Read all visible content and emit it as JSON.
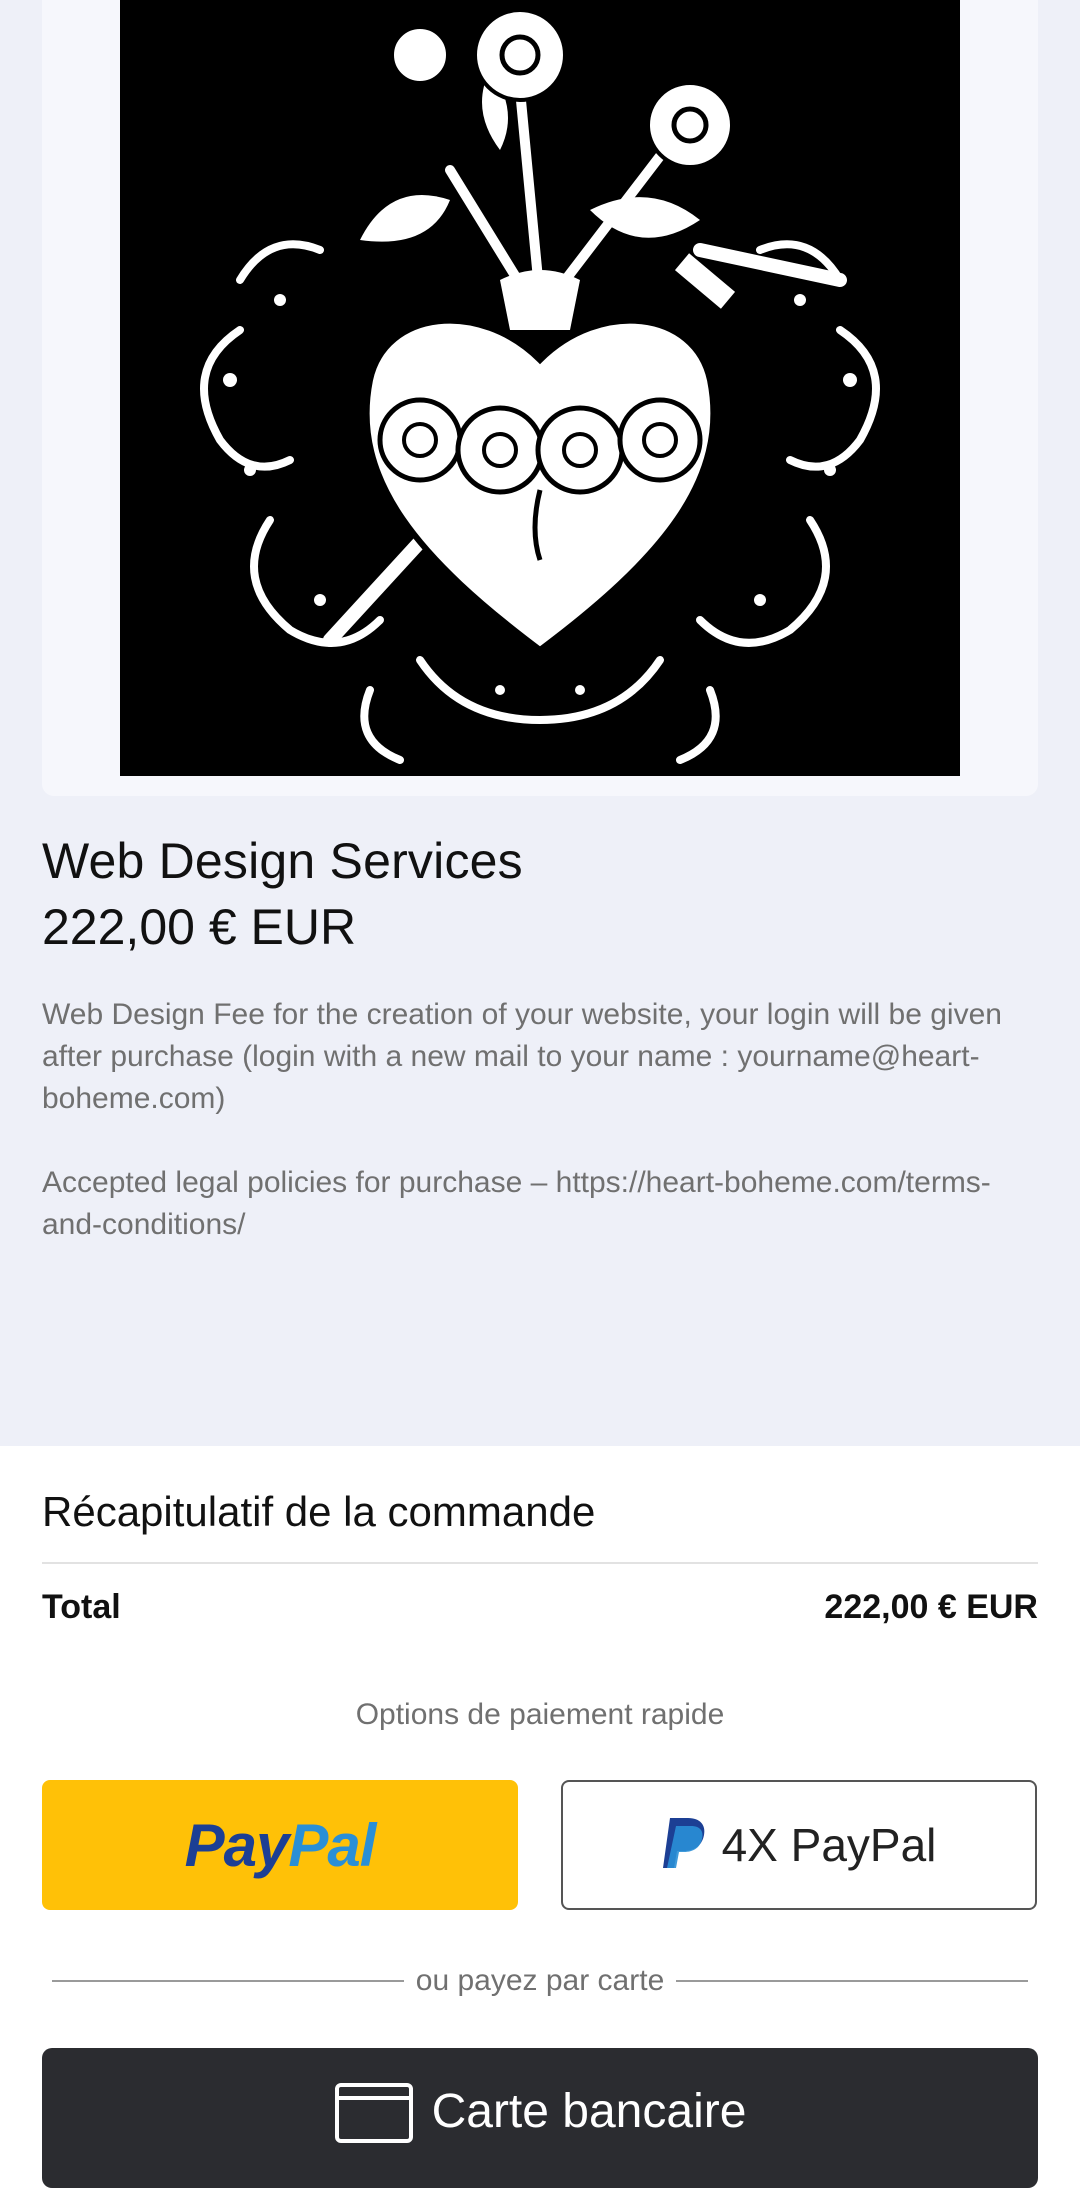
{
  "product": {
    "title": "Web Design Services",
    "price": "222,00 € EUR",
    "description_1": "Web Design Fee for the creation of your website, your login will be given after purchase (login with a new mail to your name : yourname@heart-boheme.com)",
    "description_2": "Accepted legal policies for purchase – https://heart-boheme.com/terms-and-conditions/"
  },
  "summary": {
    "title": "Récapitulatif de la commande",
    "total_label": "Total",
    "total_value": "222,00 € EUR"
  },
  "payment": {
    "fast_options_label": "Options de paiement rapide",
    "paypal_pay": "Pay",
    "paypal_pal": "Pal",
    "paypal_4x_label": "4X PayPal",
    "divider_text": "ou payez par carte",
    "card_label": "Carte bancaire"
  },
  "colors": {
    "page_bg_top": "#eef0f8",
    "paypal_yellow": "#ffc107",
    "paypal_dark_blue": "#1c3f94",
    "paypal_light_blue": "#2a8fd6",
    "card_button": "#2b2c30"
  }
}
